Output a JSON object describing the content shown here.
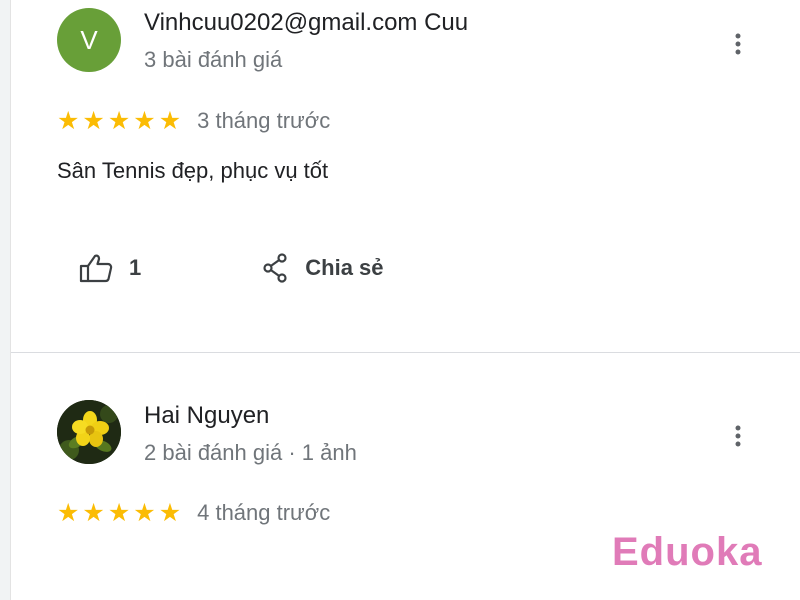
{
  "reviews": [
    {
      "avatar_letter": "V",
      "avatar_color": "#689f38",
      "author": "Vinhcuu0202@gmail.com Cuu",
      "meta": "3 bài đánh giá",
      "rating": 5,
      "time": "3 tháng trước",
      "text": "Sân Tennis đẹp, phục vụ tốt",
      "likes": "1",
      "share_label": "Chia sẻ"
    },
    {
      "avatar_icon": "yellow-flower-photo",
      "author": "Hai Nguyen",
      "meta": "2 bài đánh giá · 1 ảnh",
      "rating": 5,
      "time": "4 tháng trước"
    }
  ],
  "icons": {
    "more": "more-vert-icon",
    "star": "star-icon",
    "like": "thumb-up-icon",
    "share": "share-icon"
  },
  "colors": {
    "star": "#fbbc04",
    "secondary_text": "#70757a",
    "watermark": "#e07bb8"
  },
  "watermark": "Eduoka"
}
